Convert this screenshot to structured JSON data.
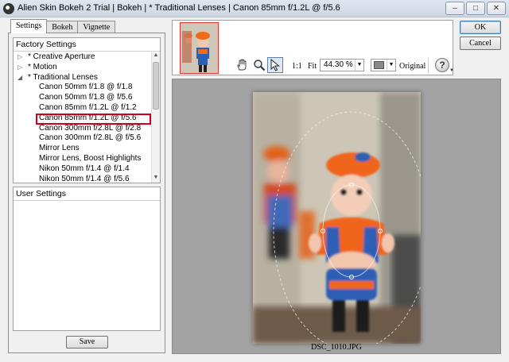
{
  "window": {
    "title": "Alien Skin Bokeh 2 Trial | Bokeh | * Traditional Lenses | Canon  85mm f/1.2L @ f/5.6",
    "minimize": "–",
    "maximize": "□",
    "close": "✕"
  },
  "tabs": [
    {
      "label": "Settings",
      "active": true
    },
    {
      "label": "Bokeh",
      "active": false
    },
    {
      "label": "Vignette",
      "active": false
    }
  ],
  "factory": {
    "header": "Factory Settings",
    "groups": [
      {
        "label": "* Creative Aperture",
        "expanded": false
      },
      {
        "label": "* Motion",
        "expanded": false
      },
      {
        "label": "* Traditional Lenses",
        "expanded": true
      }
    ],
    "items": [
      "Canon  50mm f/1.8 @ f/1.8",
      "Canon  50mm f/1.8 @ f/5.6",
      "Canon  85mm f/1.2L @ f/1.2",
      "Canon  85mm f/1.2L @ f/5.6",
      "Canon 300mm f/2.8L @ f/2.8",
      "Canon 300mm f/2.8L @ f/5.6",
      "Mirror Lens",
      "Mirror Lens, Boost Highlights",
      "Nikon  50mm f/1.4 @ f/1.4",
      "Nikon  50mm f/1.4 @ f/5.6"
    ],
    "selected_index": 3
  },
  "user": {
    "header": "User Settings"
  },
  "buttons": {
    "save": "Save",
    "ok": "OK",
    "cancel": "Cancel"
  },
  "toolbar": {
    "one_to_one": "1:1",
    "fit": "Fit",
    "zoom": "44.30 %",
    "original": "Original",
    "help": "?",
    "preview_bg_color": "#888888"
  },
  "preview": {
    "filename": "DSC_1010.JPG"
  },
  "icons": {
    "hand": "hand-icon",
    "zoom": "magnifier-icon",
    "pointer": "pointer-icon",
    "help": "help-icon"
  }
}
